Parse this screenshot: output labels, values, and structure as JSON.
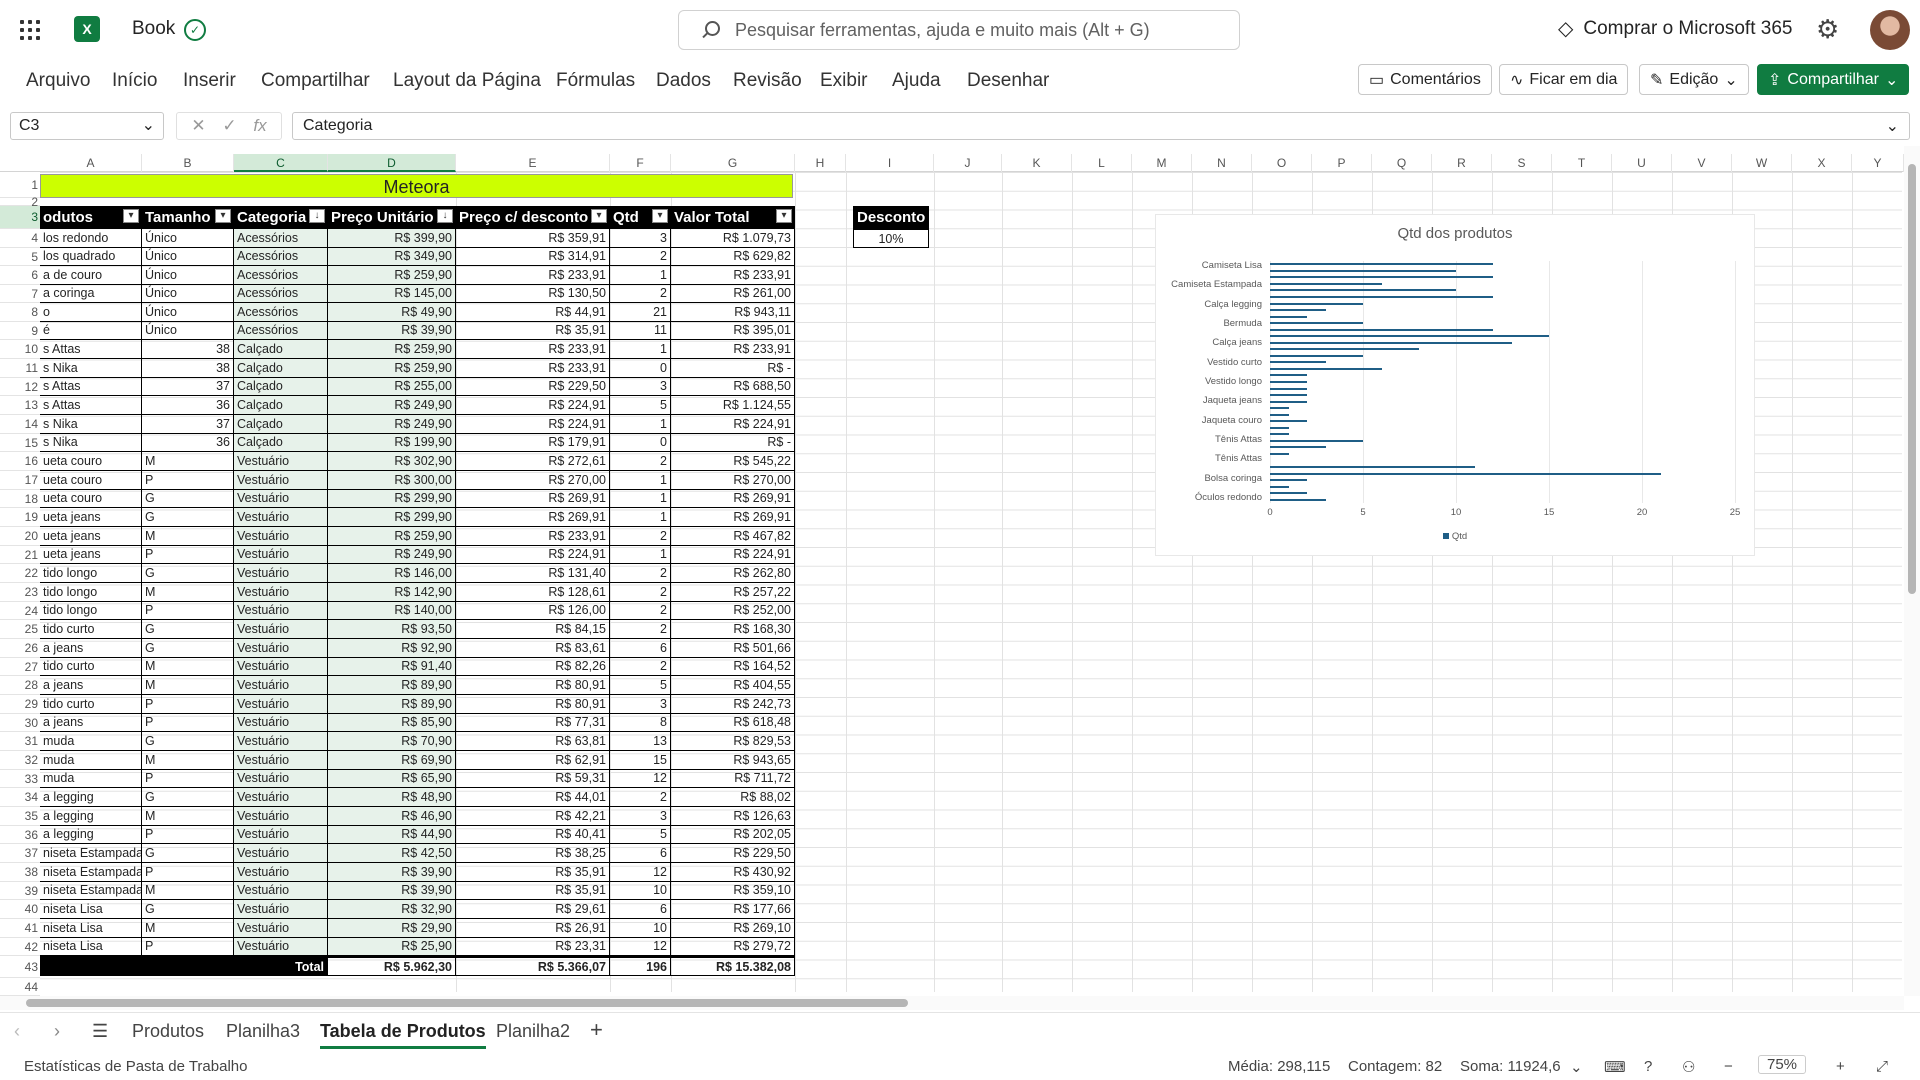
{
  "app": {
    "title": "Book",
    "search_placeholder": "Pesquisar ferramentas, ajuda e muito mais (Alt + G)",
    "buy": "Comprar o Microsoft 365"
  },
  "menu": [
    "Arquivo",
    "Início",
    "Inserir",
    "Compartilhar",
    "Layout da Página",
    "Fórmulas",
    "Dados",
    "Revisão",
    "Exibir",
    "Ajuda",
    "Desenhar"
  ],
  "ribbon_buttons": {
    "comments": "Comentários",
    "catchup": "Ficar em dia",
    "editing": "Edição",
    "share": "Compartilhar"
  },
  "formula_bar": {
    "namebox": "C3",
    "value": "Categoria"
  },
  "columns": [
    "A",
    "B",
    "C",
    "D",
    "E",
    "F",
    "G",
    "H",
    "I",
    "J",
    "K",
    "L",
    "M",
    "N",
    "O",
    "P",
    "Q",
    "R",
    "S",
    "T",
    "U",
    "V",
    "W",
    "X",
    "Y"
  ],
  "rows": [
    "1",
    "2",
    "3",
    "4",
    "5",
    "6",
    "7",
    "8",
    "9",
    "10",
    "11",
    "12",
    "13",
    "14",
    "15",
    "16",
    "17",
    "18",
    "19",
    "20",
    "21",
    "22",
    "23",
    "24",
    "25",
    "26",
    "27",
    "28",
    "29",
    "30",
    "31",
    "32",
    "33",
    "34",
    "35",
    "36",
    "37",
    "38",
    "39",
    "40",
    "41",
    "42",
    "43",
    "44"
  ],
  "sheet_title": "Meteora",
  "table_headers": [
    "odutos",
    "Tamanho",
    "Categoria",
    "Preço Unitário",
    "Preço c/ desconto",
    "Qtd",
    "Valor Total"
  ],
  "table_rows": [
    [
      "los redondo",
      "Único",
      "Acessórios",
      "R$ 399,90",
      "R$ 359,91",
      "3",
      "R$ 1.079,73"
    ],
    [
      "los quadrado",
      "Único",
      "Acessórios",
      "R$ 349,90",
      "R$ 314,91",
      "2",
      "R$ 629,82"
    ],
    [
      "a de couro",
      "Único",
      "Acessórios",
      "R$ 259,90",
      "R$ 233,91",
      "1",
      "R$ 233,91"
    ],
    [
      "a coringa",
      "Único",
      "Acessórios",
      "R$ 145,00",
      "R$ 130,50",
      "2",
      "R$ 261,00"
    ],
    [
      "o",
      "Único",
      "Acessórios",
      "R$ 49,90",
      "R$ 44,91",
      "21",
      "R$ 943,11"
    ],
    [
      "é",
      "Único",
      "Acessórios",
      "R$ 39,90",
      "R$ 35,91",
      "11",
      "R$ 395,01"
    ],
    [
      "s Attas",
      "38",
      "Calçado",
      "R$ 259,90",
      "R$ 233,91",
      "1",
      "R$ 233,91"
    ],
    [
      "s Nika",
      "38",
      "Calçado",
      "R$ 259,90",
      "R$ 233,91",
      "0",
      "R$ -"
    ],
    [
      "s Attas",
      "37",
      "Calçado",
      "R$ 255,00",
      "R$ 229,50",
      "3",
      "R$ 688,50"
    ],
    [
      "s Attas",
      "36",
      "Calçado",
      "R$ 249,90",
      "R$ 224,91",
      "5",
      "R$ 1.124,55"
    ],
    [
      "s Nika",
      "37",
      "Calçado",
      "R$ 249,90",
      "R$ 224,91",
      "1",
      "R$ 224,91"
    ],
    [
      "s Nika",
      "36",
      "Calçado",
      "R$ 199,90",
      "R$ 179,91",
      "0",
      "R$ -"
    ],
    [
      "ueta couro",
      "M",
      "Vestuário",
      "R$ 302,90",
      "R$ 272,61",
      "2",
      "R$ 545,22"
    ],
    [
      "ueta couro",
      "P",
      "Vestuário",
      "R$ 300,00",
      "R$ 270,00",
      "1",
      "R$ 270,00"
    ],
    [
      "ueta couro",
      "G",
      "Vestuário",
      "R$ 299,90",
      "R$ 269,91",
      "1",
      "R$ 269,91"
    ],
    [
      "ueta jeans",
      "G",
      "Vestuário",
      "R$ 299,90",
      "R$ 269,91",
      "1",
      "R$ 269,91"
    ],
    [
      "ueta jeans",
      "M",
      "Vestuário",
      "R$ 259,90",
      "R$ 233,91",
      "2",
      "R$ 467,82"
    ],
    [
      "ueta jeans",
      "P",
      "Vestuário",
      "R$ 249,90",
      "R$ 224,91",
      "1",
      "R$ 224,91"
    ],
    [
      "tido longo",
      "G",
      "Vestuário",
      "R$ 146,00",
      "R$ 131,40",
      "2",
      "R$ 262,80"
    ],
    [
      "tido longo",
      "M",
      "Vestuário",
      "R$ 142,90",
      "R$ 128,61",
      "2",
      "R$ 257,22"
    ],
    [
      "tido longo",
      "P",
      "Vestuário",
      "R$ 140,00",
      "R$ 126,00",
      "2",
      "R$ 252,00"
    ],
    [
      "tido curto",
      "G",
      "Vestuário",
      "R$ 93,50",
      "R$ 84,15",
      "2",
      "R$ 168,30"
    ],
    [
      "a jeans",
      "G",
      "Vestuário",
      "R$ 92,90",
      "R$ 83,61",
      "6",
      "R$ 501,66"
    ],
    [
      "tido curto",
      "M",
      "Vestuário",
      "R$ 91,40",
      "R$ 82,26",
      "2",
      "R$ 164,52"
    ],
    [
      "a jeans",
      "M",
      "Vestuário",
      "R$ 89,90",
      "R$ 80,91",
      "5",
      "R$ 404,55"
    ],
    [
      "tido curto",
      "P",
      "Vestuário",
      "R$ 89,90",
      "R$ 80,91",
      "3",
      "R$ 242,73"
    ],
    [
      "a jeans",
      "P",
      "Vestuário",
      "R$ 85,90",
      "R$ 77,31",
      "8",
      "R$ 618,48"
    ],
    [
      "muda",
      "G",
      "Vestuário",
      "R$ 70,90",
      "R$ 63,81",
      "13",
      "R$ 829,53"
    ],
    [
      "muda",
      "M",
      "Vestuário",
      "R$ 69,90",
      "R$ 62,91",
      "15",
      "R$ 943,65"
    ],
    [
      "muda",
      "P",
      "Vestuário",
      "R$ 65,90",
      "R$ 59,31",
      "12",
      "R$ 711,72"
    ],
    [
      "a legging",
      "G",
      "Vestuário",
      "R$ 48,90",
      "R$ 44,01",
      "2",
      "R$ 88,02"
    ],
    [
      "a legging",
      "M",
      "Vestuário",
      "R$ 46,90",
      "R$ 42,21",
      "3",
      "R$ 126,63"
    ],
    [
      "a legging",
      "P",
      "Vestuário",
      "R$ 44,90",
      "R$ 40,41",
      "5",
      "R$ 202,05"
    ],
    [
      "niseta Estampada",
      "G",
      "Vestuário",
      "R$ 42,50",
      "R$ 38,25",
      "6",
      "R$ 229,50"
    ],
    [
      "niseta Estampada",
      "P",
      "Vestuário",
      "R$ 39,90",
      "R$ 35,91",
      "12",
      "R$ 430,92"
    ],
    [
      "niseta Estampada",
      "M",
      "Vestuário",
      "R$ 39,90",
      "R$ 35,91",
      "10",
      "R$ 359,10"
    ],
    [
      "niseta Lisa",
      "G",
      "Vestuário",
      "R$ 32,90",
      "R$ 29,61",
      "6",
      "R$ 177,66"
    ],
    [
      "niseta Lisa",
      "M",
      "Vestuário",
      "R$ 29,90",
      "R$ 26,91",
      "10",
      "R$ 269,10"
    ],
    [
      "niseta Lisa",
      "P",
      "Vestuário",
      "R$ 25,90",
      "R$ 23,31",
      "12",
      "R$ 279,72"
    ]
  ],
  "total_row": {
    "label": "Total",
    "preco": "R$ 5.962,30",
    "desconto": "R$ 5.366,07",
    "qtd": "196",
    "valor": "R$ 15.382,08"
  },
  "desconto": {
    "label": "Desconto",
    "value": "10%"
  },
  "chart_data": {
    "type": "bar",
    "orientation": "horizontal",
    "title": "Qtd dos produtos",
    "category_labels_shown": [
      "Camiseta Lisa",
      "Camiseta Estampada",
      "Calça legging",
      "Bermuda",
      "Calça jeans",
      "Vestido curto",
      "Vestido longo",
      "Jaqueta jeans",
      "Jaqueta couro",
      "Tênis Attas",
      "Tênis Attas",
      "Bolsa coringa",
      "Óculos redondo"
    ],
    "series": [
      {
        "name": "Qtd",
        "values": [
          12,
          10,
          12,
          6,
          10,
          12,
          5,
          3,
          2,
          5,
          12,
          15,
          13,
          8,
          5,
          3,
          6,
          2,
          2,
          2,
          2,
          2,
          1,
          1,
          2,
          1,
          1,
          5,
          3,
          1,
          0,
          11,
          21,
          2,
          1,
          2,
          3
        ]
      }
    ],
    "xlim": [
      0,
      25
    ],
    "xticks": [
      "0",
      "5",
      "10",
      "15",
      "20",
      "25"
    ],
    "legend": "bottom"
  },
  "sheet_tabs": [
    "Produtos",
    "Planilha3",
    "Tabela de Produtos",
    "Planilha2"
  ],
  "active_tab": "Tabela de Produtos",
  "status": {
    "left": "Estatísticas de Pasta de Trabalho",
    "media": "Média: 298,115",
    "contagem": "Contagem: 82",
    "soma": "Soma: 11924,6",
    "zoom": "75%"
  }
}
